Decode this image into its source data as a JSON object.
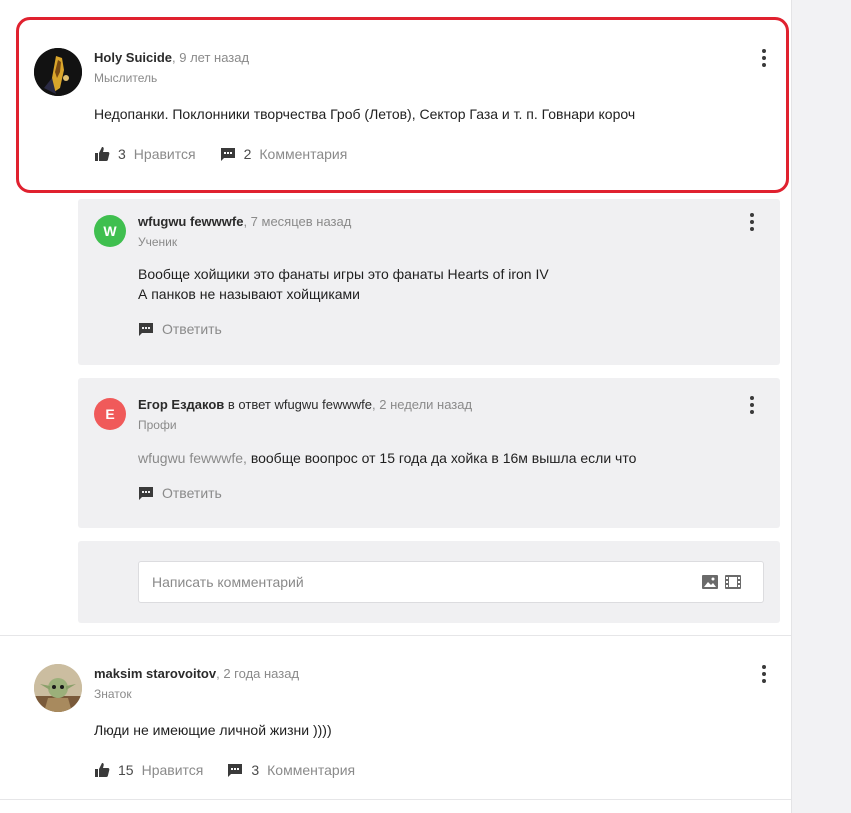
{
  "main_comment": {
    "author": "Holy Suicide",
    "time": ", 9 лет назад",
    "rank": "Мыслитель",
    "text": "Недопанки. Поклонники творчества Гроб (Летов), Сектор Газа и т. п. Говнари короч",
    "likes_count": "3",
    "likes_label": "Нравится",
    "comments_count": "2",
    "comments_label": "Комментария"
  },
  "replies": [
    {
      "avatar_letter": "W",
      "avatar_color": "#3fbf4f",
      "author": "wfugwu fewwwfe",
      "time": ", 7 месяцев назад",
      "rank": "Ученик",
      "text_line1": "Вообще хойщики это фанаты игры это фанаты Hearts of iron IV",
      "text_line2": "А панков не называют хойщиками",
      "reply_label": "Ответить"
    },
    {
      "avatar_letter": "Е",
      "avatar_color": "#f05a5a",
      "author": "Егор Ездаков",
      "reply_prefix": " в ответ ",
      "reply_target": "wfugwu fewwwfe",
      "time": ", 2 недели назад",
      "rank": "Профи",
      "mention": "wfugwu fewwwfe,",
      "text": " вообще воопрос от 15 года да хойка в 16м вышла если что",
      "reply_label": "Ответить"
    }
  ],
  "comment_input": {
    "placeholder": "Написать комментарий"
  },
  "second_comment": {
    "author": "maksim starovoitov",
    "time": ", 2 года назад",
    "rank": "Знаток",
    "text": "Люди не имеющие личной жизни ))))",
    "likes_count": "15",
    "likes_label": "Нравится",
    "comments_count": "3",
    "comments_label": "Комментария"
  },
  "colors": {
    "highlight": "#e0212f",
    "reply_bg": "#f0f0f2"
  },
  "icons": [
    "thumbs-up-icon",
    "comment-icon",
    "more-vertical-icon",
    "image-icon",
    "film-icon"
  ]
}
